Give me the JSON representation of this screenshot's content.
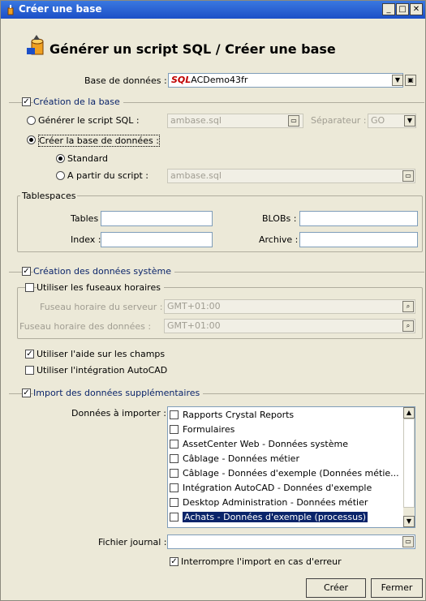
{
  "window": {
    "title": "Créer une base"
  },
  "heading": "Générer un script SQL / Créer une base",
  "database": {
    "label": "Base de données :",
    "value": "ACDemo43fr"
  },
  "creation": {
    "section_label": "Création de la base",
    "checked": true,
    "generate_script": {
      "label": "Générer le script SQL :",
      "value": "ambase.sql",
      "selected": false
    },
    "separator": {
      "label": "Séparateur :",
      "value": "GO"
    },
    "create_db": {
      "label": "Créer la base de données :",
      "selected": true
    },
    "standard": {
      "label": "Standard",
      "selected": true
    },
    "from_script": {
      "label": "A partir du script :",
      "value": "ambase.sql",
      "selected": false
    }
  },
  "tablespaces": {
    "group_label": "Tablespaces",
    "tables_label": "Tables :",
    "tables_value": "",
    "index_label": "Index :",
    "index_value": "",
    "blobs_label": "BLOBs :",
    "blobs_value": "",
    "archive_label": "Archive :",
    "archive_value": ""
  },
  "system": {
    "section_label": "Création des données système",
    "checked": true,
    "timezones": {
      "label": "Utiliser les fuseaux horaires",
      "checked": false
    },
    "server_tz": {
      "label": "Fuseau horaire du serveur :",
      "value": "GMT+01:00"
    },
    "data_tz": {
      "label": "Fuseau horaire des données :",
      "value": "GMT+01:00"
    },
    "field_help": {
      "label": "Utiliser l'aide sur les champs",
      "checked": true
    },
    "autocad": {
      "label": "Utiliser l'intégration AutoCAD",
      "checked": false
    }
  },
  "import": {
    "section_label": "Import des données supplémentaires",
    "checked": true,
    "data_label": "Données à importer :",
    "items": [
      {
        "label": "Rapports Crystal Reports",
        "checked": false,
        "selected": false
      },
      {
        "label": "Formulaires",
        "checked": false,
        "selected": false
      },
      {
        "label": "AssetCenter Web - Données système",
        "checked": false,
        "selected": false
      },
      {
        "label": "Câblage - Données métier",
        "checked": false,
        "selected": false
      },
      {
        "label": "Câblage - Données d'exemple (Données métie...",
        "checked": false,
        "selected": false
      },
      {
        "label": "Intégration AutoCAD - Données d'exemple",
        "checked": false,
        "selected": false
      },
      {
        "label": "Desktop Administration - Données métier",
        "checked": false,
        "selected": false
      },
      {
        "label": "Achats - Données d'exemple (processus)",
        "checked": false,
        "selected": true
      }
    ],
    "log_label": "Fichier journal :",
    "log_value": "",
    "stop_on_error": {
      "label": "Interrompre l'import en cas d'erreur",
      "checked": true
    }
  },
  "buttons": {
    "create": "Créer",
    "close": "Fermer"
  },
  "colors": {
    "titlebar": "#1c4fc7",
    "selection": "#0a246a",
    "dialog_bg": "#ece9d8"
  }
}
